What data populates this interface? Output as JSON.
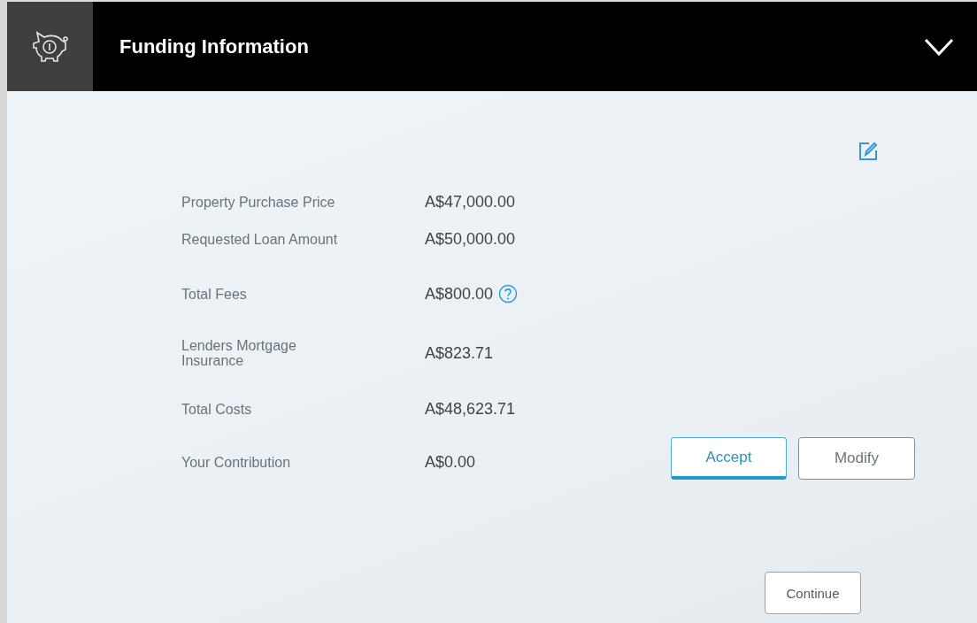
{
  "panel": {
    "title": "Funding Information",
    "expanded": true
  },
  "rows": [
    {
      "label": "Property Purchase Price",
      "value": "A$47,000.00",
      "has_help": false
    },
    {
      "label": "Requested Loan Amount",
      "value": "A$50,000.00",
      "has_help": false
    },
    {
      "label": "Total Fees",
      "value": "A$800.00",
      "has_help": true
    },
    {
      "label": "Lenders Mortgage Insurance",
      "value": "A$823.71",
      "has_help": false
    },
    {
      "label": "Total Costs",
      "value": "A$48,623.71",
      "has_help": false
    },
    {
      "label": "Your Contribution",
      "value": "A$0.00",
      "has_help": false
    }
  ],
  "actions": [
    {
      "label": "Accept",
      "kind": "primary"
    },
    {
      "label": "Modify",
      "kind": "secondary"
    }
  ],
  "continue": {
    "label": "Continue"
  }
}
